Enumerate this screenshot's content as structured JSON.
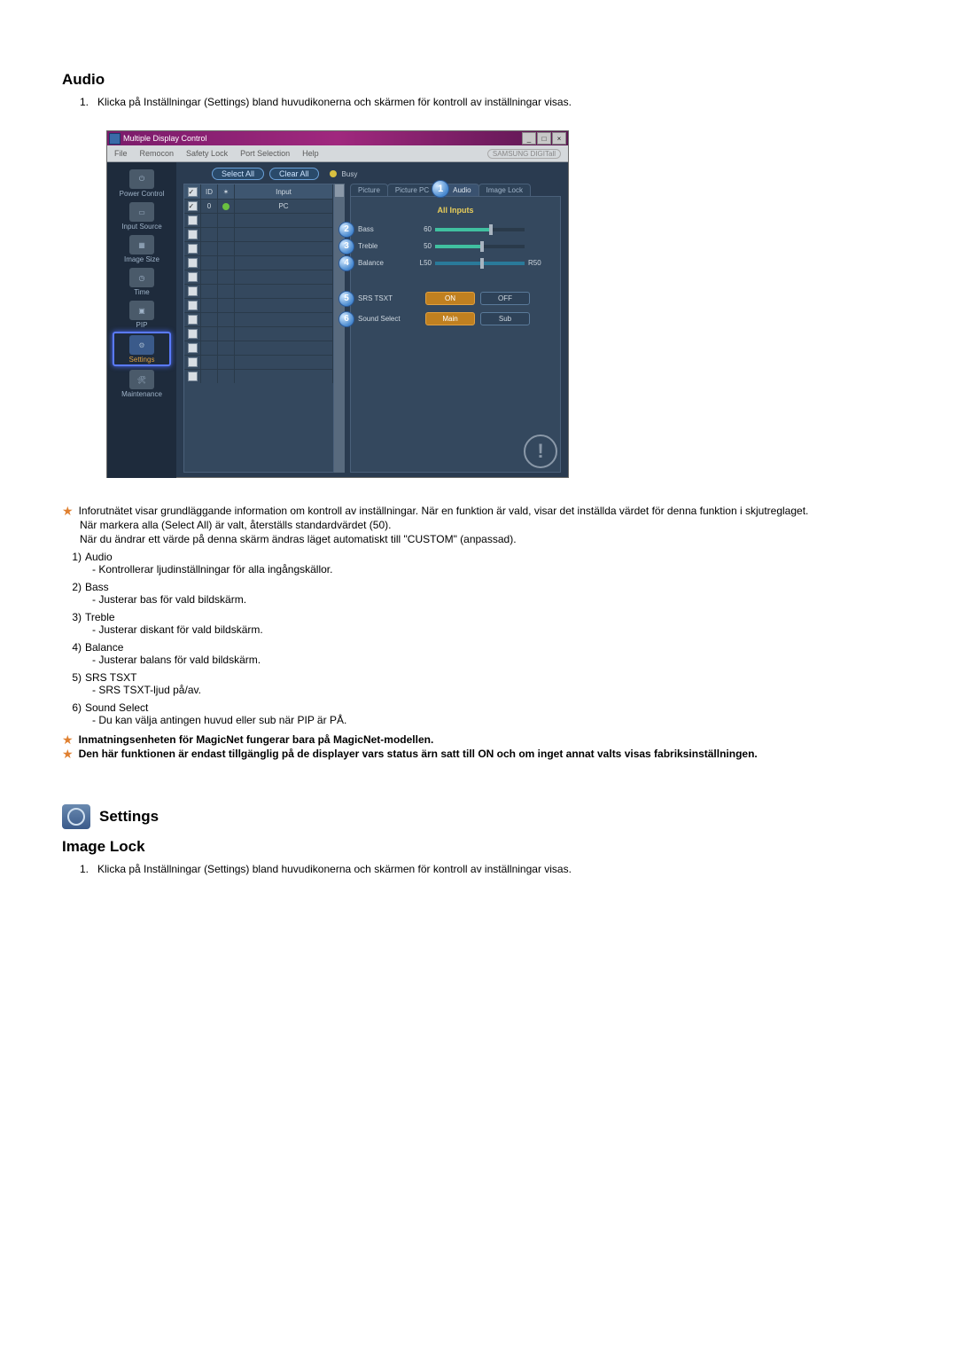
{
  "section1": {
    "title": "Audio",
    "intro_num": "1.",
    "intro_text": "Klicka på Inställningar (Settings) bland huvudikonerna och skärmen för kontroll av inställningar visas."
  },
  "app": {
    "window_title": "Multiple Display Control",
    "menubar": [
      "File",
      "Remocon",
      "Safety Lock",
      "Port Selection",
      "Help"
    ],
    "brand": "SAMSUNG DIGITall",
    "sidebar": [
      {
        "label": "Power Control"
      },
      {
        "label": "Input Source"
      },
      {
        "label": "Image Size"
      },
      {
        "label": "Time"
      },
      {
        "label": "PIP"
      },
      {
        "label": "Settings"
      },
      {
        "label": "Maintenance"
      }
    ],
    "toolbar": {
      "select_all": "Select All",
      "clear_all": "Clear All",
      "busy": "Busy"
    },
    "grid": {
      "headers": {
        "id": "ID",
        "input": "Input"
      },
      "row0": {
        "id": "0",
        "input": "PC"
      }
    },
    "tabs": {
      "picture": "Picture",
      "picture_pc": "Picture PC",
      "audio": "Audio",
      "image_lock": "Image Lock"
    },
    "panel": {
      "all_inputs": "All Inputs",
      "bass": {
        "label": "Bass",
        "value": "60"
      },
      "treble": {
        "label": "Treble",
        "value": "50"
      },
      "balance": {
        "label": "Balance",
        "left": "L50",
        "right": "R50"
      },
      "srs": {
        "label": "SRS TSXT",
        "on": "ON",
        "off": "OFF"
      },
      "sound_select": {
        "label": "Sound Select",
        "main": "Main",
        "sub": "Sub"
      }
    },
    "markers": {
      "m1": "1",
      "m2": "2",
      "m3": "3",
      "m4": "4",
      "m5": "5",
      "m6": "6"
    }
  },
  "desc": {
    "star1": "Inforutnätet visar grundläggande information om kontroll av inställningar. När en funktion är vald, visar det inställda värdet för denna funktion i skjutreglaget.",
    "plain1": "När markera alla (Select All) är valt, återställs standardvärdet (50).",
    "plain2": "När du ändrar ett värde på denna skärm ändras läget automatiskt till \"CUSTOM\" (anpassad).",
    "items": [
      {
        "n": "1)",
        "t": "Audio",
        "d": "- Kontrollerar ljudinställningar för alla ingångskällor."
      },
      {
        "n": "2)",
        "t": "Bass",
        "d": "- Justerar bas för vald bildskärm."
      },
      {
        "n": "3)",
        "t": "Treble",
        "d": "- Justerar diskant för vald bildskärm."
      },
      {
        "n": "4)",
        "t": "Balance",
        "d": "- Justerar balans för vald bildskärm."
      },
      {
        "n": "5)",
        "t": "SRS TSXT",
        "d": "- SRS TSXT-ljud på/av."
      },
      {
        "n": "6)",
        "t": "Sound Select",
        "d": "- Du kan välja antingen huvud eller sub när PIP är PÅ."
      }
    ],
    "star2": "Inmatningsenheten för MagicNet fungerar bara på MagicNet-modellen.",
    "star3": "Den här funktionen är endast tillgänglig på de displayer vars status ärn satt till ON och om inget annat valts visas fabriksinställningen."
  },
  "section2": {
    "header": "Settings",
    "title": "Image Lock",
    "intro_num": "1.",
    "intro_text": "Klicka på Inställningar (Settings) bland huvudikonerna och skärmen för kontroll av inställningar visas."
  }
}
